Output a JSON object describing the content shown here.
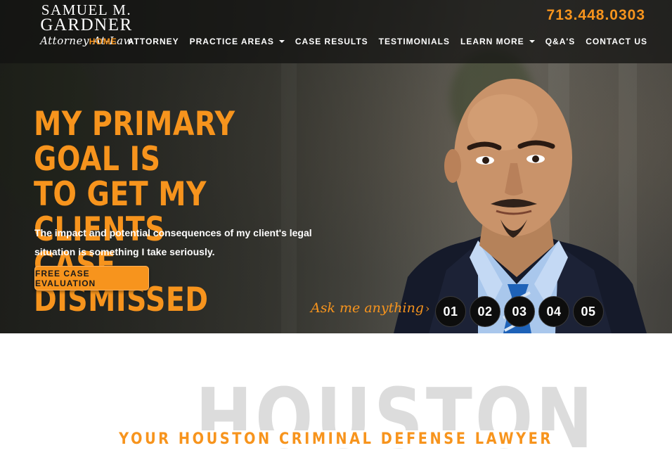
{
  "logo": {
    "line1": "SAMUEL M.",
    "line2": "GARDNER",
    "line3": "Attorney-At-Law"
  },
  "header": {
    "phone": "713.448.0303"
  },
  "nav": {
    "items": [
      {
        "label": "HOME",
        "active": true,
        "dropdown": false
      },
      {
        "label": "ATTORNEY",
        "active": false,
        "dropdown": false
      },
      {
        "label": "PRACTICE AREAS",
        "active": false,
        "dropdown": true
      },
      {
        "label": "CASE RESULTS",
        "active": false,
        "dropdown": false
      },
      {
        "label": "TESTIMONIALS",
        "active": false,
        "dropdown": false
      },
      {
        "label": "LEARN MORE",
        "active": false,
        "dropdown": true
      },
      {
        "label": "Q&A'S",
        "active": false,
        "dropdown": false
      },
      {
        "label": "CONTACT US",
        "active": false,
        "dropdown": false
      }
    ]
  },
  "hero": {
    "headline_1": "MY PRIMARY GOAL IS",
    "headline_2": "TO GET MY CLIENTS",
    "headline_3": "CASE DISMISSED",
    "subtext": "The impact and potential consequences of my client's legal situation is something I take seriously.",
    "cta_label": "FREE CASE EVALUATION",
    "ask_label": "Ask me anything",
    "ask_arrow": "›",
    "steps": [
      "01",
      "02",
      "03",
      "04",
      "05"
    ]
  },
  "section": {
    "watermark": "HOUSTON",
    "tagline": "YOUR HOUSTON CRIMINAL DEFENSE LAWYER"
  },
  "colors": {
    "accent": "#f7941d",
    "dark": "#121210",
    "white": "#ffffff",
    "watermark": "#dcdcdc"
  }
}
